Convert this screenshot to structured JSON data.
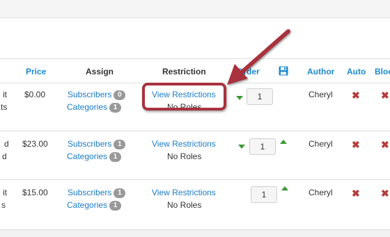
{
  "columns": {
    "price": "Price",
    "assign": "Assign",
    "restriction": "Restriction",
    "order": "Order",
    "author": "Author",
    "auto": "Auto",
    "blocked": "Bloc"
  },
  "rows": [
    {
      "left_line1": "it",
      "left_line2": "ts",
      "price": "$0.00",
      "subscribers_label": "Subscribers",
      "subscribers_count": "0",
      "categories_label": "Categories",
      "categories_count": "1",
      "restriction_link": "View Restrictions",
      "restriction_roles": "No Roles",
      "order": "1",
      "author": "Cheryl"
    },
    {
      "left_line1": "d",
      "left_line2": "d",
      "price": "$23.00",
      "subscribers_label": "Subscribers",
      "subscribers_count": "1",
      "categories_label": "Categories",
      "categories_count": "1",
      "restriction_link": "View Restrictions",
      "restriction_roles": "No Roles",
      "order": "1",
      "author": "Cheryl"
    },
    {
      "left_line1": "it",
      "left_line2": "s",
      "price": "$15.00",
      "subscribers_label": "Subscribers",
      "subscribers_count": "1",
      "categories_label": "Categories",
      "categories_count": "1",
      "restriction_link": "View Restrictions",
      "restriction_roles": "No Roles",
      "order": "1",
      "author": "Cheryl"
    }
  ],
  "icons": {
    "save": "floppy-disk-icon",
    "move_up": "triangle-up-icon",
    "move_down": "triangle-down-icon",
    "unpublished": "x-icon"
  },
  "colors": {
    "link": "#1a7cc7",
    "badge": "#999999",
    "order_arrow": "#3a9a35",
    "x_mark": "#b73b3b",
    "annotation": "#a8323e"
  }
}
